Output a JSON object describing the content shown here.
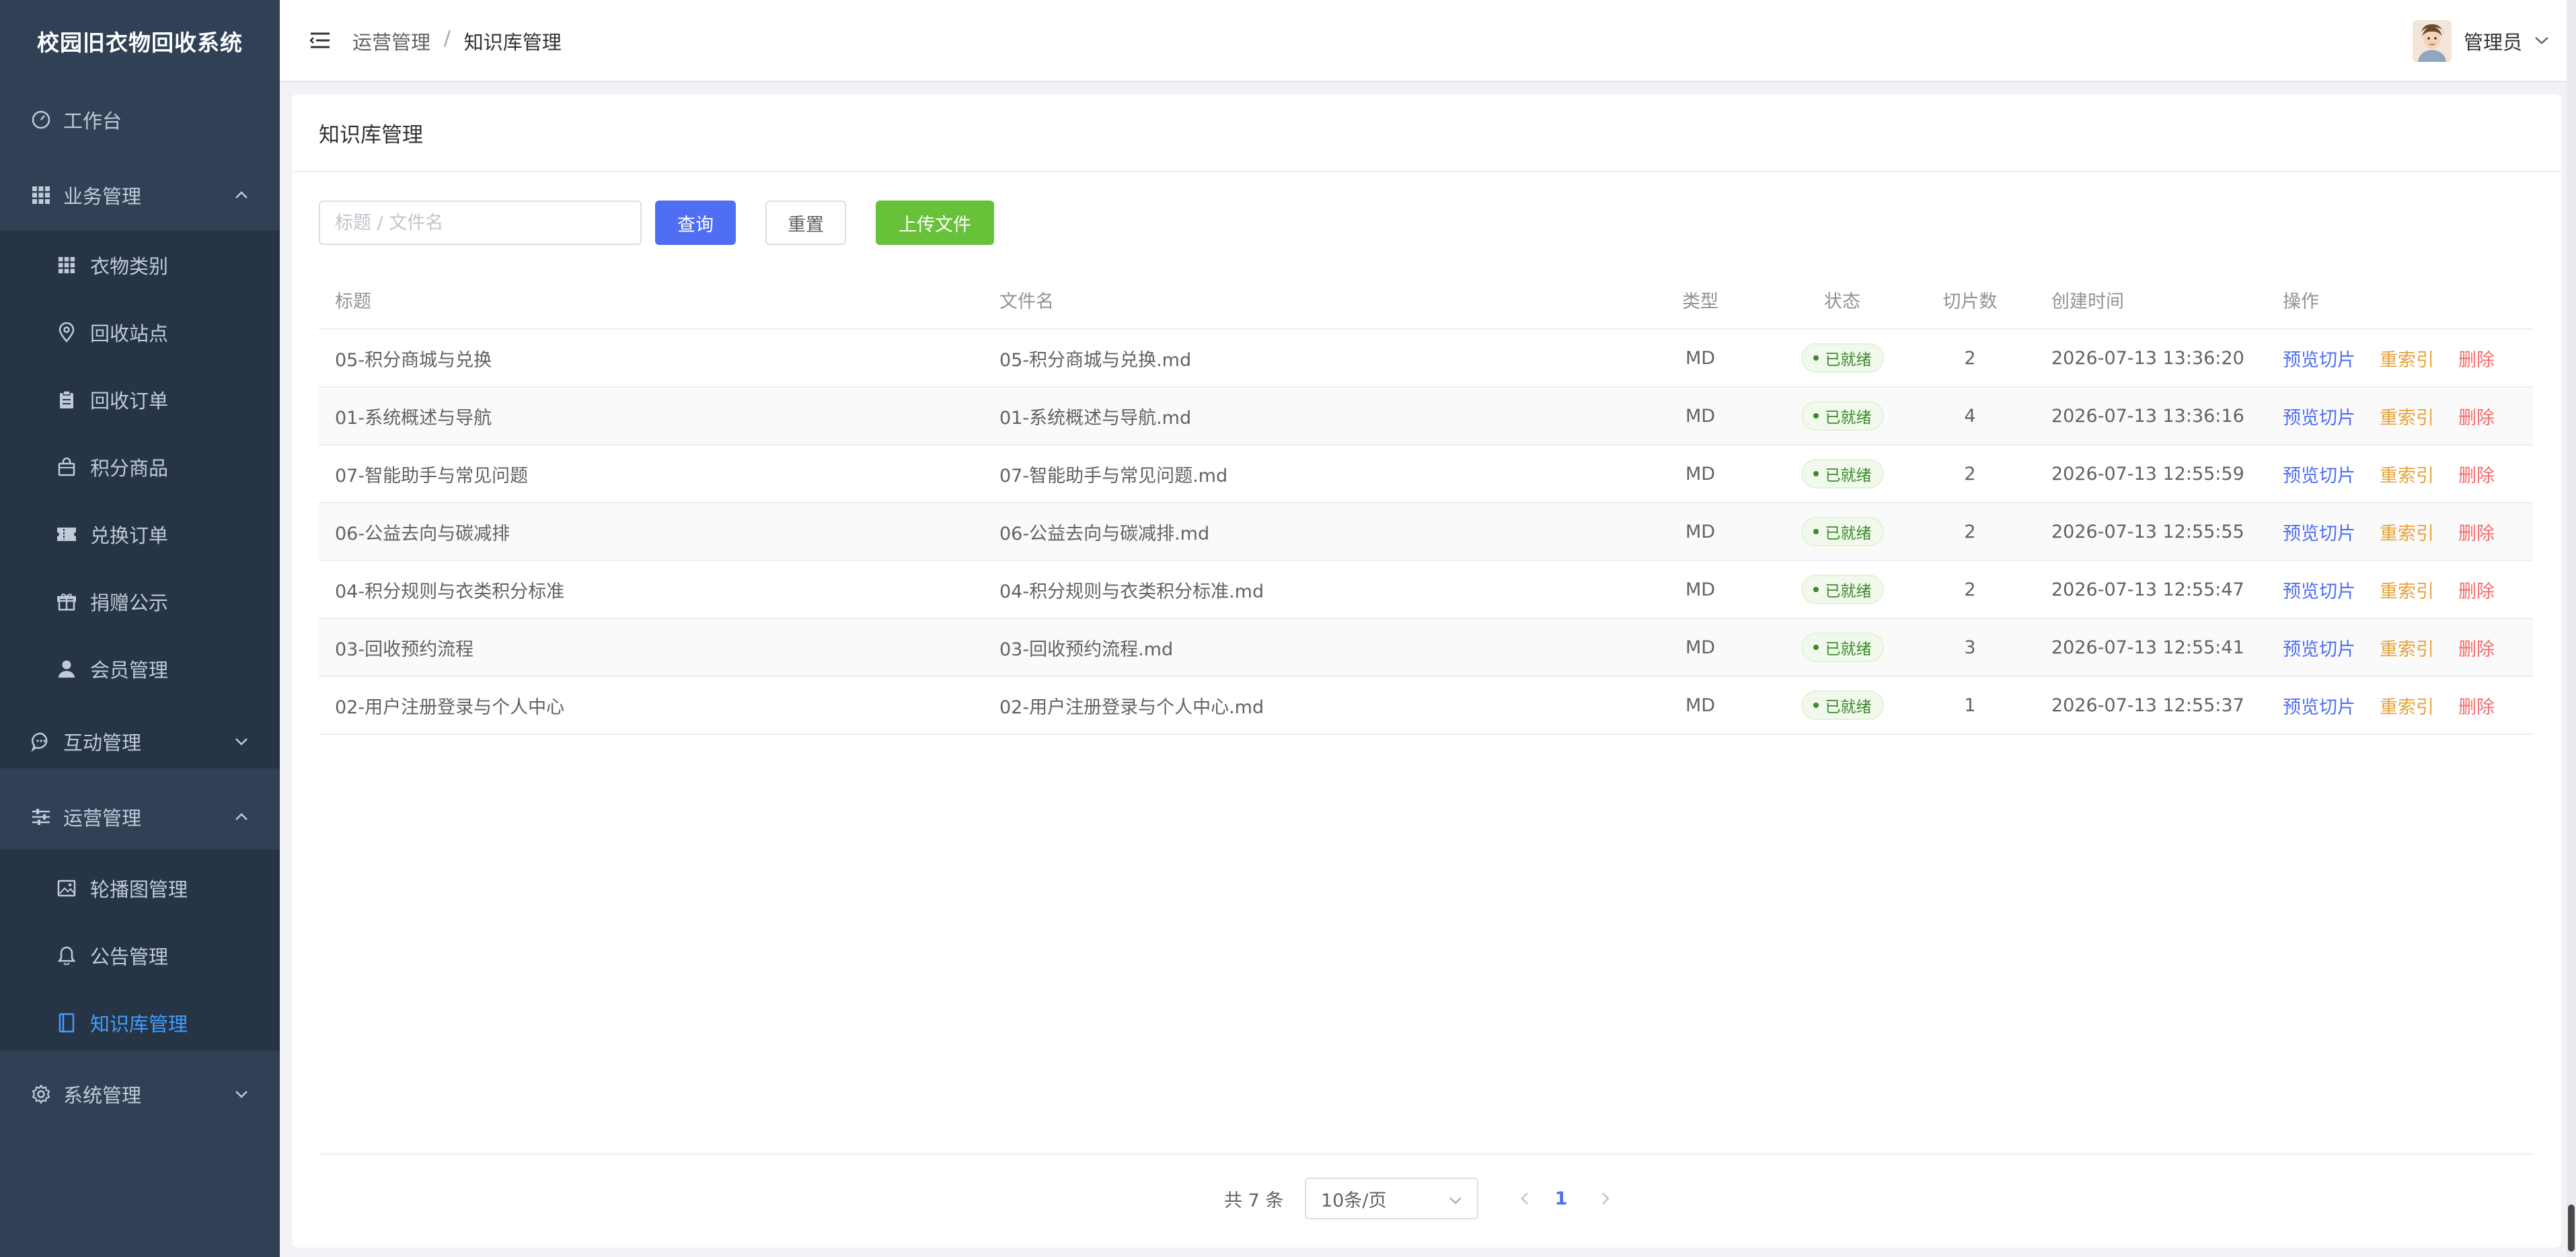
{
  "app_title": "校园旧衣物回收系统",
  "sidebar": {
    "items": [
      {
        "label": "工作台",
        "icon": "dashboard-icon"
      },
      {
        "label": "业务管理",
        "icon": "grid-icon",
        "expanded": true
      },
      {
        "label": "衣物类别",
        "icon": "grid-icon"
      },
      {
        "label": "回收站点",
        "icon": "location-icon"
      },
      {
        "label": "回收订单",
        "icon": "clipboard-icon"
      },
      {
        "label": "积分商品",
        "icon": "shopping-bag-icon"
      },
      {
        "label": "兑换订单",
        "icon": "ticket-icon"
      },
      {
        "label": "捐赠公示",
        "icon": "gift-icon"
      },
      {
        "label": "会员管理",
        "icon": "user-icon"
      },
      {
        "label": "互动管理",
        "icon": "chat-icon",
        "expanded": false
      },
      {
        "label": "运营管理",
        "icon": "sliders-icon",
        "expanded": true
      },
      {
        "label": "轮播图管理",
        "icon": "image-icon"
      },
      {
        "label": "公告管理",
        "icon": "bell-icon"
      },
      {
        "label": "知识库管理",
        "icon": "book-icon",
        "active": true
      },
      {
        "label": "系统管理",
        "icon": "gear-icon",
        "expanded": false
      }
    ]
  },
  "header": {
    "breadcrumb": [
      "运营管理",
      "知识库管理"
    ],
    "breadcrumb_sep": "/",
    "user_name": "管理员"
  },
  "page": {
    "title": "知识库管理",
    "search_placeholder": "标题 / 文件名",
    "query_label": "查询",
    "reset_label": "重置",
    "upload_label": "上传文件"
  },
  "table": {
    "columns": [
      "标题",
      "文件名",
      "类型",
      "状态",
      "切片数",
      "创建时间",
      "操作"
    ],
    "rows": [
      {
        "title": "05-积分商城与兑换",
        "file": "05-积分商城与兑换.md",
        "type": "MD",
        "status": "已就绪",
        "chunks": "2",
        "time": "2026-07-13 13:36:20"
      },
      {
        "title": "01-系统概述与导航",
        "file": "01-系统概述与导航.md",
        "type": "MD",
        "status": "已就绪",
        "chunks": "4",
        "time": "2026-07-13 13:36:16"
      },
      {
        "title": "07-智能助手与常见问题",
        "file": "07-智能助手与常见问题.md",
        "type": "MD",
        "status": "已就绪",
        "chunks": "2",
        "time": "2026-07-13 12:55:59"
      },
      {
        "title": "06-公益去向与碳减排",
        "file": "06-公益去向与碳减排.md",
        "type": "MD",
        "status": "已就绪",
        "chunks": "2",
        "time": "2026-07-13 12:55:55"
      },
      {
        "title": "04-积分规则与衣类积分标准",
        "file": "04-积分规则与衣类积分标准.md",
        "type": "MD",
        "status": "已就绪",
        "chunks": "2",
        "time": "2026-07-13 12:55:47"
      },
      {
        "title": "03-回收预约流程",
        "file": "03-回收预约流程.md",
        "type": "MD",
        "status": "已就绪",
        "chunks": "3",
        "time": "2026-07-13 12:55:41"
      },
      {
        "title": "02-用户注册登录与个人中心",
        "file": "02-用户注册登录与个人中心.md",
        "type": "MD",
        "status": "已就绪",
        "chunks": "1",
        "time": "2026-07-13 12:55:37"
      }
    ],
    "ops": {
      "preview": "预览切片",
      "reindex": "重索引",
      "delete": "删除"
    }
  },
  "pagination": {
    "total_text": "共 7 条",
    "page_size": "10条/页",
    "current_page": "1"
  },
  "colors": {
    "sidebar_bg": "#304156",
    "accent": "#4f6ef2",
    "success": "#67c23a",
    "warning": "#e6a23c",
    "danger": "#f56c6c"
  }
}
